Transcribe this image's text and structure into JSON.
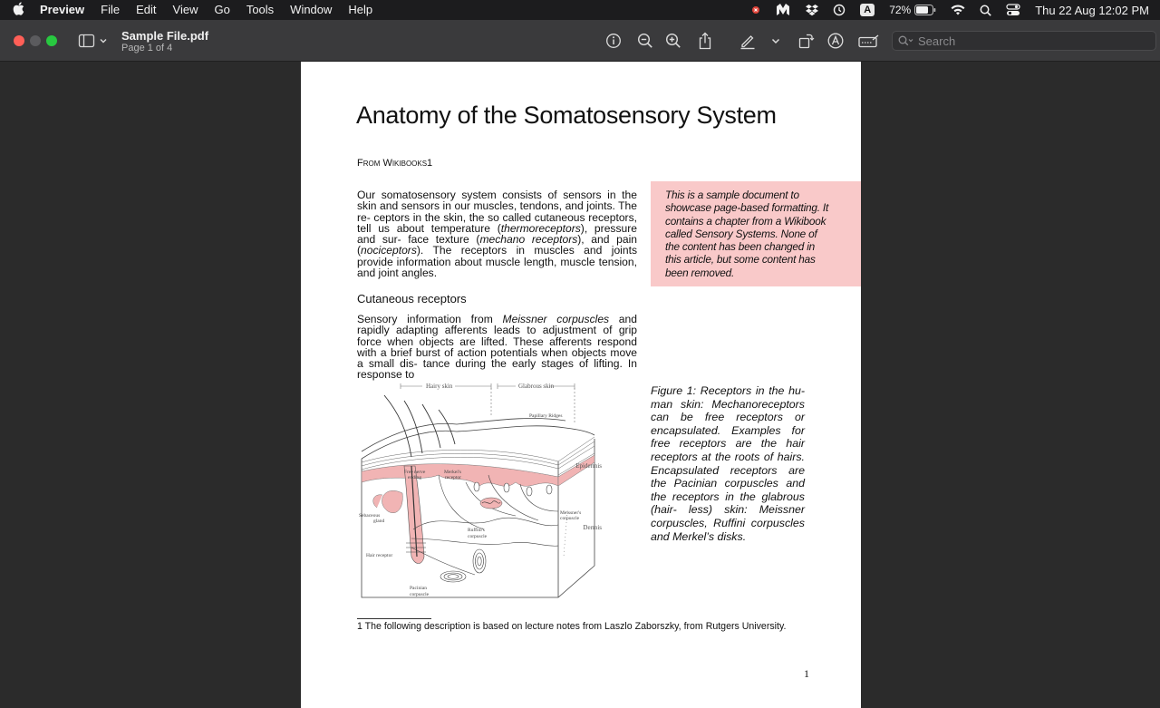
{
  "menubar": {
    "app_name": "Preview",
    "items": [
      "File",
      "Edit",
      "View",
      "Go",
      "Tools",
      "Window",
      "Help"
    ],
    "keyboard_badge": "A",
    "battery": "72%",
    "clock": "Thu 22 Aug  12:02 PM"
  },
  "window": {
    "title": "Sample File.pdf",
    "subtitle": "Page 1 of 4"
  },
  "toolbar": {
    "icons": [
      "info-icon",
      "zoom-out-icon",
      "zoom-in-icon",
      "share-icon",
      "highlight-pen-icon",
      "chevron-down-icon",
      "rotate-icon",
      "markup-icon",
      "signature-icon"
    ],
    "search_placeholder": "Search"
  },
  "document": {
    "heading": "Anatomy of the Somatosensory System",
    "byline": "From Wikibooks1",
    "para1_parts": [
      {
        "text": "Our somatosensory system consists of sensors in the skin and sensors in our muscles, tendons, and joints. The re- ceptors in the skin, the so called cutaneous receptors, tell us about temperature ("
      },
      {
        "text": "thermoreceptors",
        "italic": true
      },
      {
        "text": "), pressure and sur- face texture ("
      },
      {
        "text": "mechano receptors",
        "italic": true
      },
      {
        "text": "), and pain ("
      },
      {
        "text": "nociceptors",
        "italic": true
      },
      {
        "text": "). The receptors in muscles and joints provide information about muscle length, muscle tension, and joint angles."
      }
    ],
    "section_heading": "Cutaneous receptors",
    "para2_parts": [
      {
        "text": "Sensory information from "
      },
      {
        "text": "Meissner corpuscles",
        "italic": true
      },
      {
        "text": " and rapidly adapting afferents leads to adjustment of grip force when objects are lifted. These afferents respond with a brief burst of action potentials when objects move a small dis- tance during the early stages of lifting. In response to"
      }
    ],
    "note": "This is a sample document to showcase page-based formatting. It contains a chapter from a Wikibook called Sensory Systems. None of the content has been changed in this article, but some content has been removed.",
    "figure_caption": "Figure 1: Receptors in the hu- man skin: Mechanoreceptors can be free receptors or encapsulated. Examples for free receptors are the hair receptors at the roots of hairs. Encapsulated receptors are the Pacinian corpuscles and the receptors in the glabrous (hair- less) skin: Meissner corpuscles, Ruffini corpuscles and Merkel’s disks.",
    "figure_labels": {
      "hairy_skin": "Hairy skin",
      "glabrous_skin": "Glabrous skin",
      "papillary_ridges": "Papillary Ridges",
      "epidermis": "Epidermis",
      "dermis": "Dermis",
      "free_nerve": "Free nerve",
      "ending": "ending",
      "merkels": "Merkel's",
      "receptor": "receptor",
      "sebaceous": "Sebaceous",
      "gland": "gland",
      "ruffinis": "Ruffini's",
      "corpuscle": "corpuscle",
      "meissners": "Meissner's",
      "hair_receptor": "Hair receptor",
      "pacinian": "Pacinian"
    },
    "footnote": "1 The following description is based on lecture notes from Laszlo Zaborszky, from Rutgers University.",
    "page_number": "1"
  },
  "colors": {
    "note_background": "#f9c9c9",
    "close_button": "#ff5f57",
    "zoom_button": "#28c840"
  }
}
